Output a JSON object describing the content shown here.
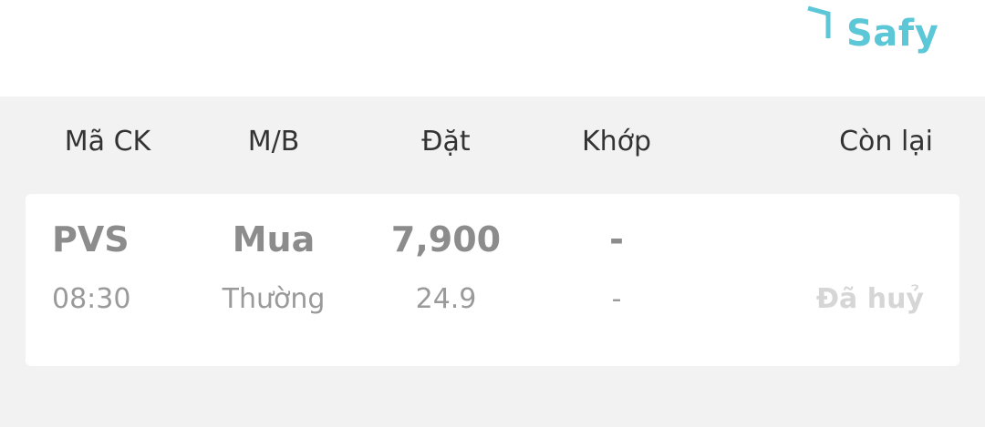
{
  "brand": {
    "name": "Safy",
    "color": "#5cc7d6",
    "icon": "bracket-logo-icon"
  },
  "columns": {
    "symbol": "Mã CK",
    "side": "M/B",
    "order": "Đặt",
    "matched": "Khớp",
    "remaining": "Còn lại"
  },
  "orders": [
    {
      "symbol": "PVS",
      "time": "08:30",
      "side": "Mua",
      "order_type": "Thường",
      "quantity": "7,900",
      "price": "24.9",
      "matched_quantity": "-",
      "matched_price": "-",
      "status": "Đã huỷ"
    }
  ]
}
